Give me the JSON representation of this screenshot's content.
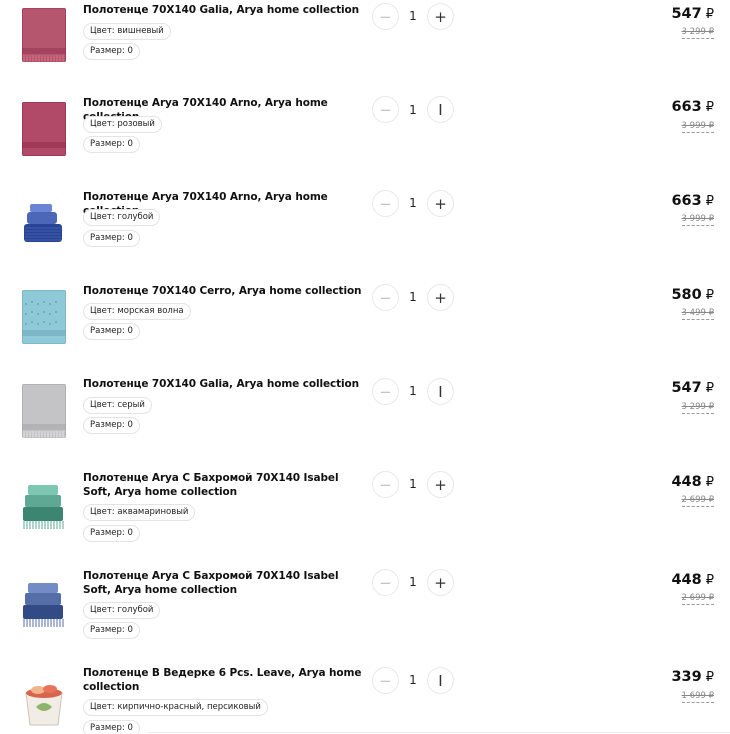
{
  "currency_symbol": "₽",
  "items": [
    {
      "title": "Полотенце 70X140 Galia, Arya home collection",
      "color_label": "Цвет: вишневый",
      "size_label": "Размер: 0",
      "quantity": "1",
      "minus_symbol": "−",
      "plus_symbol": "+",
      "price": "547",
      "old_price": "3 299 ₽",
      "thumb_color": "#b5556e",
      "thumb_pattern": "fringe-towel"
    },
    {
      "title": "Полотенце Arya 70X140 Arno, Arya home collection",
      "color_label": "Цвет: розовый",
      "size_label": "Размер: 0",
      "quantity": "1",
      "minus_symbol": "−",
      "plus_symbol": "I",
      "price": "663",
      "old_price": "3 999 ₽",
      "thumb_color": "#b04a68",
      "thumb_pattern": "plain-towel"
    },
    {
      "title": "Полотенце Arya 70X140 Arno, Arya home collection",
      "color_label": "Цвет: голубой",
      "size_label": "Размер: 0",
      "quantity": "1",
      "minus_symbol": "−",
      "plus_symbol": "+",
      "price": "663",
      "old_price": "3 999 ₽",
      "thumb_color": "#4c66b8",
      "thumb_pattern": "towel-stack"
    },
    {
      "title": "Полотенце 70X140 Cerro, Arya home collection",
      "color_label": "Цвет: морская волна",
      "size_label": "Размер: 0",
      "quantity": "1",
      "minus_symbol": "−",
      "plus_symbol": "+",
      "price": "580",
      "old_price": "3 499 ₽",
      "thumb_color": "#8ec9d8",
      "thumb_pattern": "stitched-towel"
    },
    {
      "title": "Полотенце 70X140 Galia, Arya home collection",
      "color_label": "Цвет: серый",
      "size_label": "Размер: 0",
      "quantity": "1",
      "minus_symbol": "−",
      "plus_symbol": "I",
      "price": "547",
      "old_price": "3 299 ₽",
      "thumb_color": "#c4c4c6",
      "thumb_pattern": "fringe-towel"
    },
    {
      "title": "Полотенце Arya С Бахромой 70X140 Isabel Soft, Arya home collection",
      "color_label": "Цвет: аквамариновый",
      "size_label": "Размер: 0",
      "quantity": "1",
      "minus_symbol": "−",
      "plus_symbol": "+",
      "price": "448",
      "old_price": "2 699 ₽",
      "thumb_color": "#5fa894",
      "thumb_pattern": "fringe-stack"
    },
    {
      "title": "Полотенце Arya С Бахромой 70X140 Isabel Soft, Arya home collection",
      "color_label": "Цвет: голубой",
      "size_label": "Размер: 0",
      "quantity": "1",
      "minus_symbol": "−",
      "plus_symbol": "+",
      "price": "448",
      "old_price": "2 699 ₽",
      "thumb_color": "#566ea8",
      "thumb_pattern": "fringe-stack"
    },
    {
      "title": "Полотенце В Ведерке 6 Pcs. Leave, Arya home collection",
      "color_label": "Цвет: кирпично-красный, персиковый",
      "size_label": "Размер: 0",
      "quantity": "1",
      "minus_symbol": "−",
      "plus_symbol": "I",
      "price": "339",
      "old_price": "1 699 ₽",
      "thumb_color": "#d9644e",
      "thumb_pattern": "bucket-set"
    }
  ]
}
